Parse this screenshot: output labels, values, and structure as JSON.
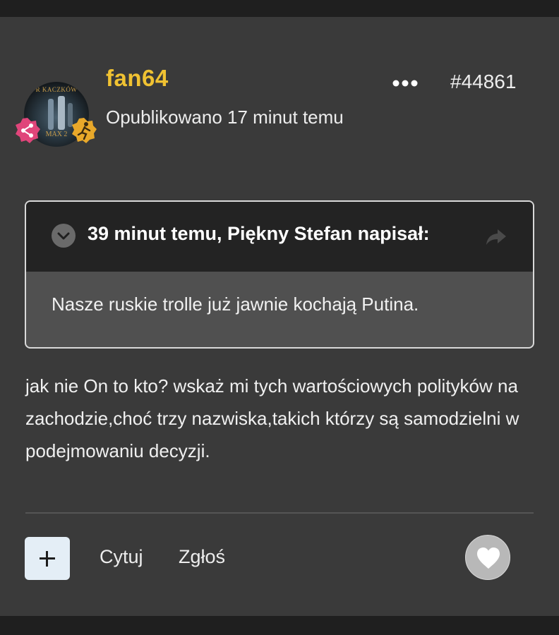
{
  "post": {
    "username": "fan64",
    "published": "Opublikowano 17 minut temu",
    "post_id": "#44861",
    "avatar_text_top": "R KACZKÓW",
    "avatar_text_bottom": "MAX 2",
    "quote": {
      "citation": "39 minut temu, Piękny Stefan napisał:",
      "text": "Nasze ruskie trolle już jawnie kochają Putina."
    },
    "content": "jak nie On to kto? wskaż mi tych wartościowych polityków na zachodzie,choć trzy nazwiska,takich którzy są samodzielni w podejmowaniu decyzji."
  },
  "actions": {
    "quote_label": "Cytuj",
    "report_label": "Zgłoś"
  },
  "icons": {
    "more": "more-horizontal-icon",
    "toggle": "chevron-down-icon",
    "share": "share-arrow-icon",
    "plus": "plus-icon",
    "heart": "heart-icon",
    "badge_left": "share-nodes-icon",
    "badge_right": "runner-icon"
  },
  "colors": {
    "username": "#f0c232",
    "badge_left": "#e0457a",
    "badge_right": "#e8a82a"
  }
}
